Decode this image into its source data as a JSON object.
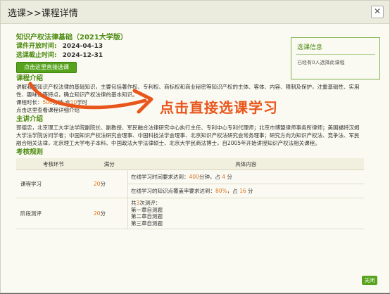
{
  "window": {
    "title": "选课>>课程详情",
    "close_glyph": "✕"
  },
  "course": {
    "name": "知识产权法律基础（2021大学版）",
    "open_label": "课件开放时间:",
    "open_date": "2024-04-13",
    "close_label": "选课截止时间:",
    "close_date": "2024-12-31",
    "enroll_button": "点击这里直接选课"
  },
  "annotation": {
    "text": "点击直接选课学习",
    "color": "#e8561c"
  },
  "side_panel": {
    "title": "选课信息",
    "text": "已经有0人选择此课程"
  },
  "intro": {
    "heading": "课程介绍",
    "text": "讲解我国知识产权法律的基础知识，主要包括著作权、专利权、商标权和商业秘密等知识产权的主体、客体、内容、限制及保护，注重基础性、实用性、趣味性等特点，确立知识产权法律的基本知识。",
    "hours_prefix": "课程时长：",
    "minutes": "500",
    "minutes_unit": "分钟",
    "hours_join": "合",
    "hours": "10",
    "hours_unit": "学时",
    "more_link": "点击这里查看课程详细介绍"
  },
  "lecturer": {
    "heading": "主讲介绍",
    "text": "郭德忠，北京理工大学法学院副院长、副教授、军民融合法律研究中心执行主任、专利中心专利代理师；北京市博盟律师事务所律师；美国福特汉姆大学法学院访问学者；中国知识产权法研究会理事、中国科技法学会理事、北京知识产权法研究会常务理事；研究方向为知识产权法、竞争法、军民融合相关法律，北京理工大学电子本科、中国政法大学法律硕士、北京大学民商法博士，自2005年开始讲授知识产权法相关课程。"
  },
  "rules": {
    "heading": "考核规则",
    "headers": [
      "考核环节",
      "满分",
      "具体内容"
    ],
    "rows": [
      {
        "item": "课程学习",
        "score": "20",
        "unit": "分",
        "lines": [
          {
            "pre": "在线学习时间要求达到：",
            "val": "400",
            "mid": "分钟，占",
            "val2": "4",
            "post": "分"
          },
          {
            "pre": "在线学习的知识点覆盖率要求达到：",
            "val": "80%",
            "mid": "，占",
            "val2": "16",
            "post": "分"
          }
        ]
      },
      {
        "item": "阶段测评",
        "score": "20",
        "unit": "分",
        "count_pre": "共",
        "count": "3",
        "count_post": "次测评：",
        "tests": [
          "第一章自测题",
          "第二章自测题",
          "第三章自测题"
        ]
      }
    ]
  },
  "footer": {
    "close_button": "关闭"
  }
}
